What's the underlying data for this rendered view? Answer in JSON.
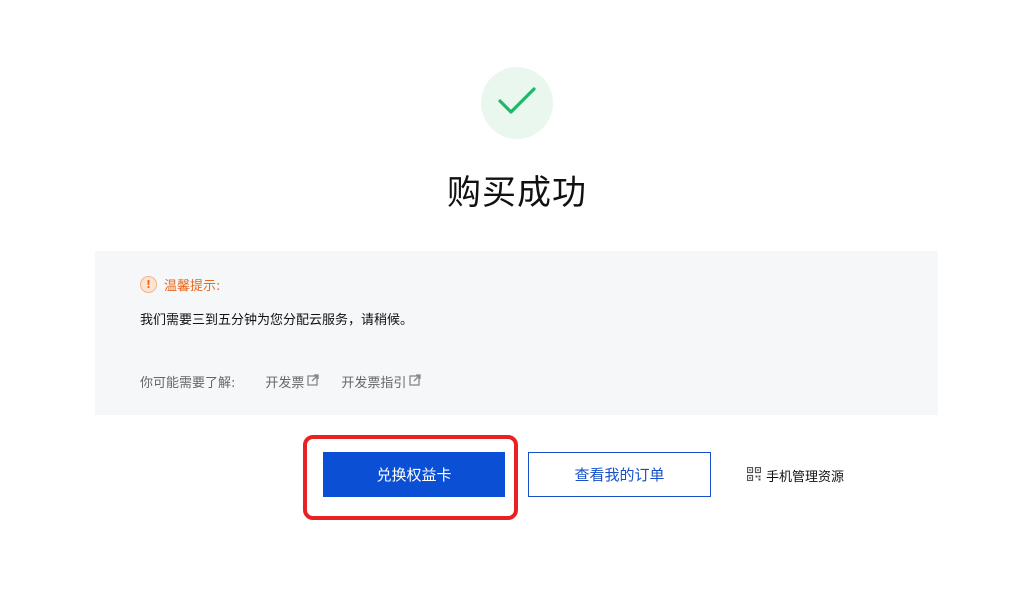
{
  "result": {
    "title": "购买成功",
    "icon": "check-icon",
    "icon_color": "#1fb86a"
  },
  "notice": {
    "icon": "warning-icon",
    "icon_glyph": "!",
    "title": "温馨提示:",
    "body": "我们需要三到五分钟为您分配云服务，请稍候。",
    "links_label": "你可能需要了解:",
    "links": [
      {
        "label": "开发票",
        "icon": "external-link-icon"
      },
      {
        "label": "开发票指引",
        "icon": "external-link-icon"
      }
    ]
  },
  "actions": {
    "primary_label": "兑换权益卡",
    "secondary_label": "查看我的订单",
    "mobile_label": "手机管理资源",
    "mobile_icon": "qr-code-icon",
    "primary_color": "#0a4fd4",
    "highlight_color": "#e82222"
  }
}
